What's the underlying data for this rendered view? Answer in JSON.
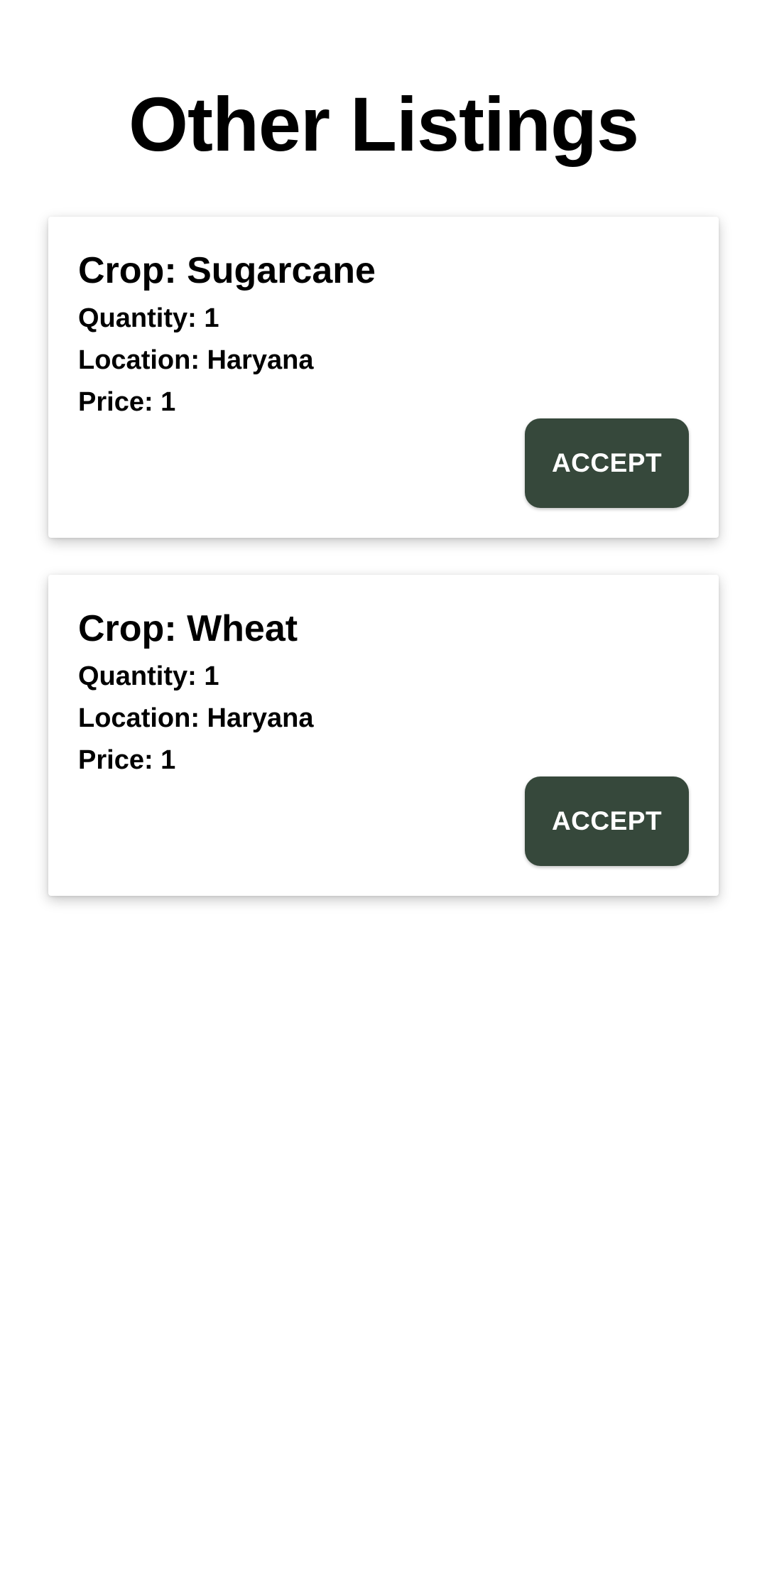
{
  "page": {
    "title": "Other Listings"
  },
  "colors": {
    "accept_button_bg": "#36483b",
    "accept_button_text": "#ffffff",
    "background": "#ffffff",
    "text": "#000000"
  },
  "listings": [
    {
      "crop": "Crop: Sugarcane",
      "quantity": "Quantity: 1",
      "location": "Location: Haryana",
      "price": "Price: 1",
      "accept_label": "ACCEPT"
    },
    {
      "crop": "Crop: Wheat",
      "quantity": "Quantity: 1",
      "location": "Location: Haryana",
      "price": "Price: 1",
      "accept_label": "ACCEPT"
    }
  ]
}
